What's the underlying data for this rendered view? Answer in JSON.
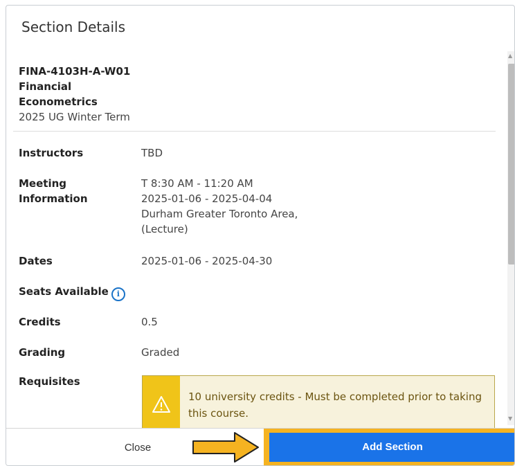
{
  "dialog": {
    "title": "Section Details"
  },
  "course": {
    "code": "FINA-4103H-A-W01",
    "name": "Financial Econometrics",
    "term": "2025 UG Winter Term"
  },
  "details": {
    "instructors_label": "Instructors",
    "instructors_value": "TBD",
    "meeting_label_line1": "Meeting",
    "meeting_label_line2": "Information",
    "meeting_time": "T 8:30 AM - 11:20 AM",
    "meeting_dates": "2025-01-06 - 2025-04-04",
    "meeting_location": "Durham Greater Toronto Area,",
    "meeting_type": "(Lecture)",
    "dates_label": "Dates",
    "dates_value": "2025-01-06 - 2025-04-30",
    "seats_label": "Seats Available",
    "credits_label": "Credits",
    "credits_value": "0.5",
    "grading_label": "Grading",
    "grading_value": "Graded",
    "requisites_label": "Requisites"
  },
  "alert": {
    "text": "10 university credits - Must be completed prior to taking this course.",
    "icon": "warning-icon",
    "color": "#f0c419"
  },
  "footer": {
    "close_label": "Close",
    "add_label": "Add Section",
    "accent": "#1a73e8",
    "highlight": "#f5b321"
  }
}
